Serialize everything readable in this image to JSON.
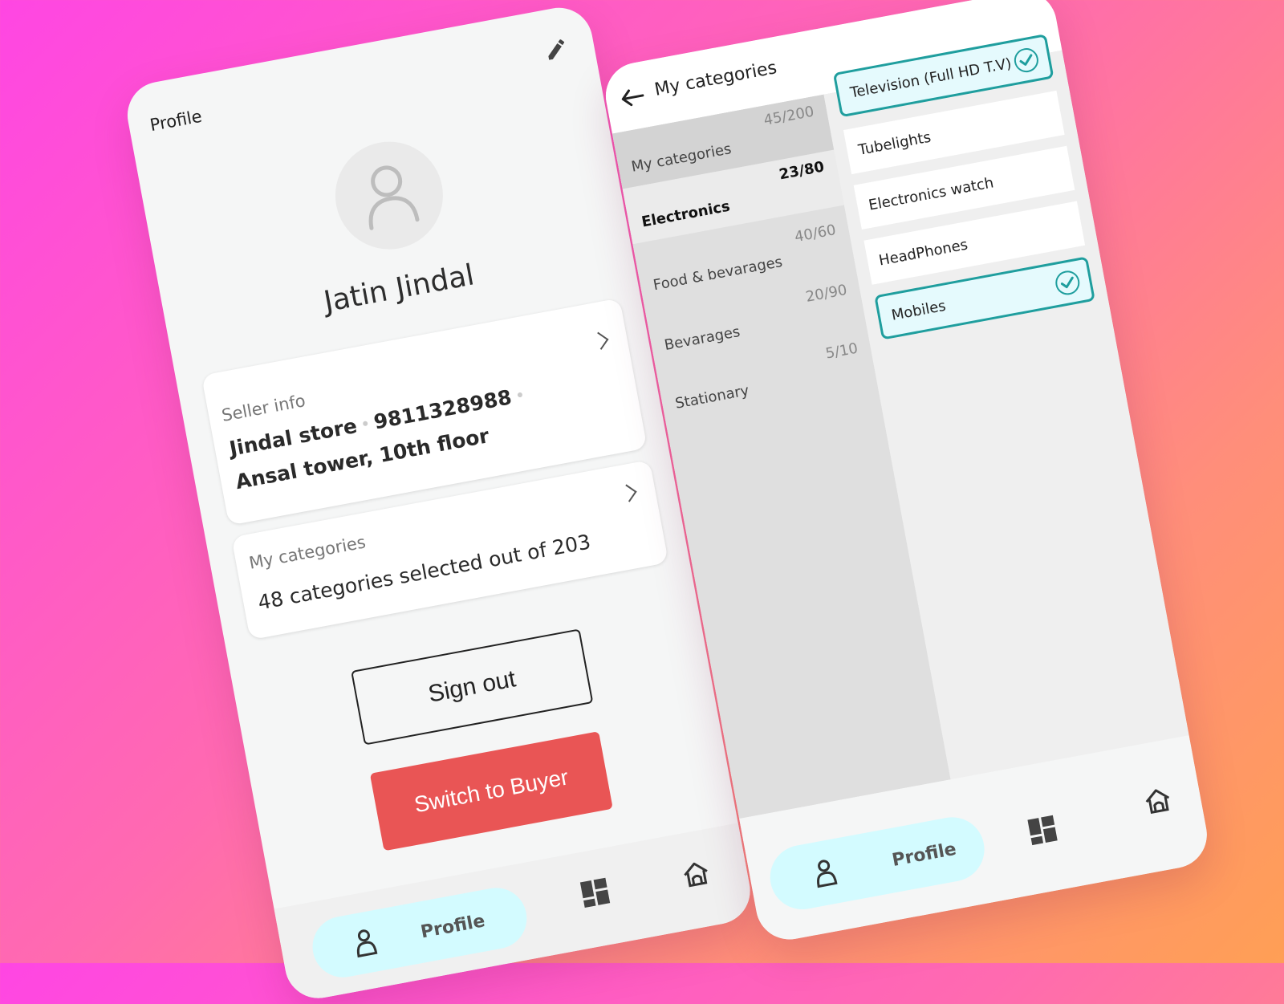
{
  "profile_screen": {
    "title": "Profile",
    "user_name": "Jatin Jindal",
    "seller_info": {
      "label": "Seller info",
      "store": "Jindal store",
      "phone": "9811328988",
      "address": "Ansal tower, 10th floor"
    },
    "categories_card": {
      "label": "My categories",
      "summary": "48 categories selected out of 203"
    },
    "sign_out_label": "Sign out",
    "switch_label": "Switch to Buyer",
    "nav": {
      "profile_label": "Profile"
    }
  },
  "categories_screen": {
    "title": "My categories",
    "left_categories": [
      {
        "name": "My categories",
        "count": "45/200"
      },
      {
        "name": "Electronics",
        "count": "23/80"
      },
      {
        "name": "Food & bevarages",
        "count": "40/60"
      },
      {
        "name": "Bevarages",
        "count": "20/90"
      },
      {
        "name": "Stationary",
        "count": "5/10"
      }
    ],
    "items": [
      {
        "label": "Television (Full HD T.V)",
        "selected": true
      },
      {
        "label": "Tubelights",
        "selected": false
      },
      {
        "label": "Electronics watch",
        "selected": false
      },
      {
        "label": "HeadPhones",
        "selected": false
      },
      {
        "label": "Mobiles",
        "selected": true
      }
    ],
    "nav": {
      "profile_label": "Profile"
    }
  },
  "colors": {
    "accent_red": "#e95555",
    "teal": "#1f9e9e",
    "pill_bg": "#d3fbff"
  },
  "icons": [
    "pencil-icon",
    "user-icon",
    "chevron-right-icon",
    "grid-icon",
    "home-icon",
    "back-arrow-icon",
    "check-icon"
  ]
}
